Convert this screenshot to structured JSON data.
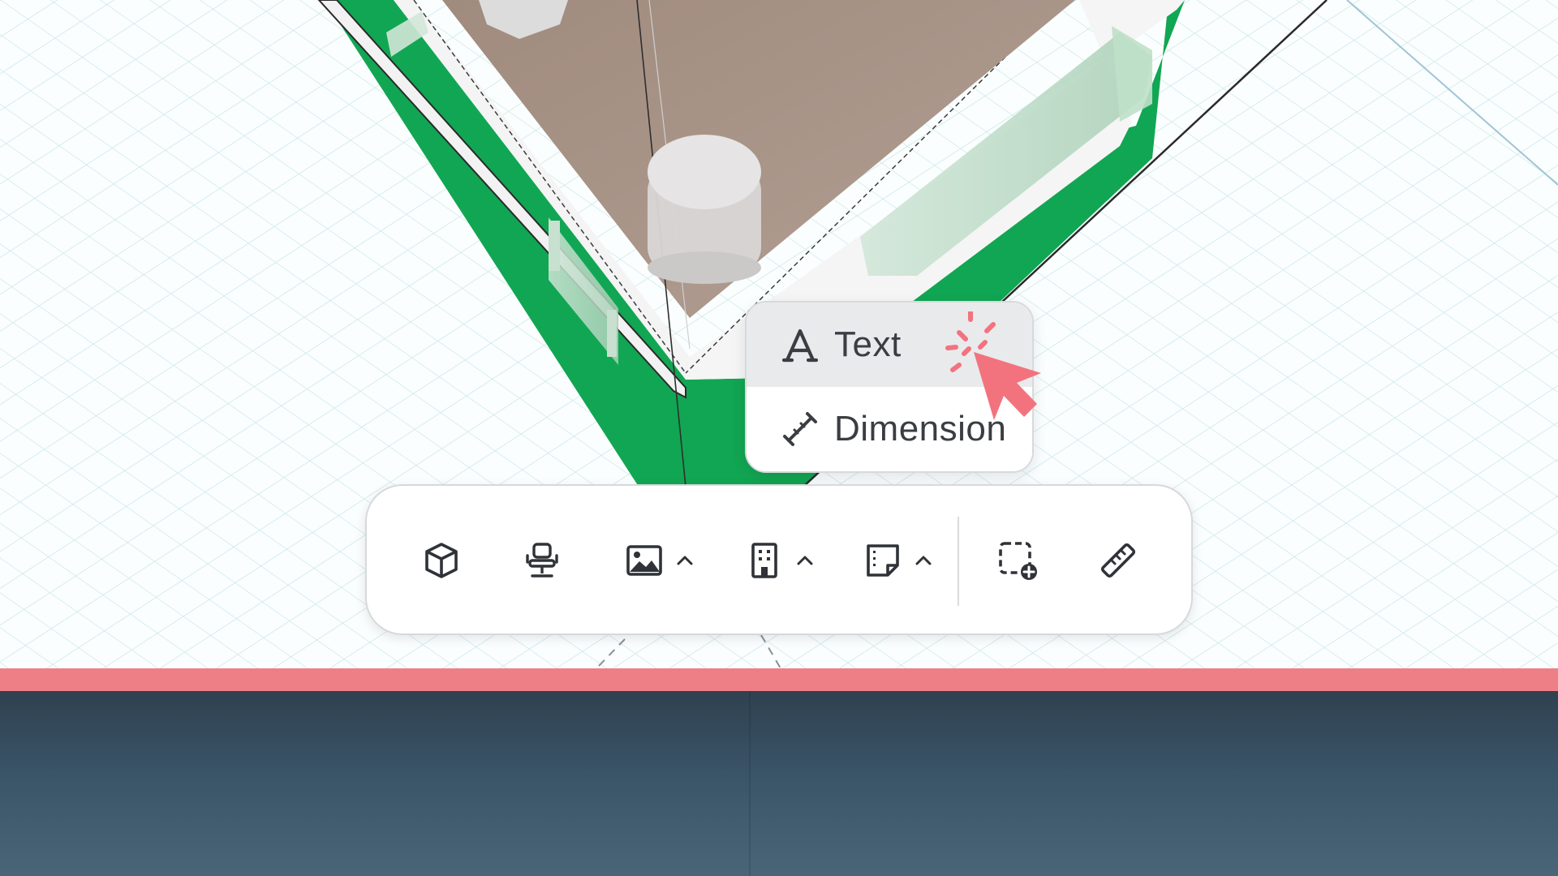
{
  "colors": {
    "accent": "#ef7f86",
    "wall_green": "#11a653",
    "floor": "#a89487",
    "grid_line": "#cfe8e8",
    "icon_dark": "#3a3d42",
    "cursor_pink": "#f2737e"
  },
  "popup_menu": {
    "items": [
      {
        "label": "Text",
        "icon": "letter-a-icon",
        "highlighted": true
      },
      {
        "label": "Dimension",
        "icon": "dimension-arrow-icon",
        "highlighted": false
      }
    ]
  },
  "toolbar": {
    "tools": [
      {
        "name": "3d-box-tool",
        "icon": "cube-icon",
        "has_dropdown": false
      },
      {
        "name": "furniture-tool",
        "icon": "office-chair-icon",
        "has_dropdown": false
      },
      {
        "name": "image-tool",
        "icon": "image-icon",
        "has_dropdown": true
      },
      {
        "name": "building-tool",
        "icon": "building-icon",
        "has_dropdown": true
      },
      {
        "name": "note-tool",
        "icon": "sticky-note-icon",
        "has_dropdown": true
      },
      {
        "name": "add-area-tool",
        "icon": "dashed-square-plus-icon",
        "has_dropdown": false
      },
      {
        "name": "measure-tool",
        "icon": "ruler-icon",
        "has_dropdown": false
      }
    ]
  },
  "cursor": {
    "icon": "pointer-click-icon"
  }
}
